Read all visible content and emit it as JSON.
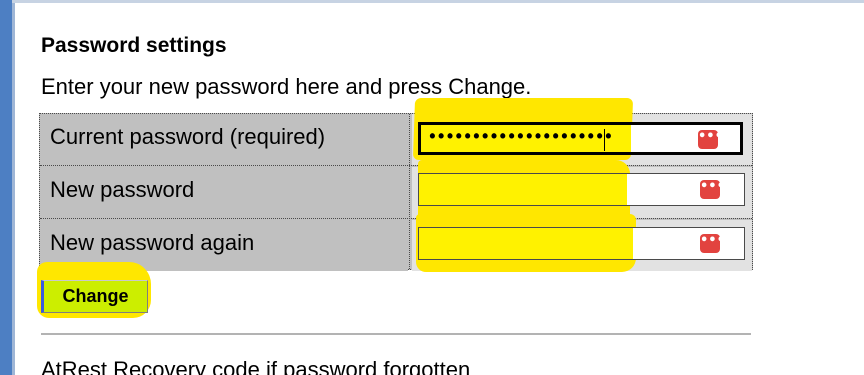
{
  "section": {
    "title": "Password settings",
    "description": "Enter your new password here and press Change."
  },
  "form": {
    "rows": [
      {
        "label": "Current password (required)",
        "value": "•••••••••••••••••••••",
        "icon": "password-manager-icon",
        "focused": true
      },
      {
        "label": "New password",
        "value": "",
        "icon": "password-manager-icon",
        "focused": false
      },
      {
        "label": "New password again",
        "value": "",
        "icon": "password-manager-icon",
        "focused": false
      }
    ],
    "submit_label": "Change"
  },
  "next_section": {
    "title": "AtRest Recovery code if password forgotten"
  },
  "colors": {
    "highlighter": "#ffe700",
    "autofill_yellow": "#fff200",
    "button_bg": "#ccee00",
    "icon_red": "#e2433f",
    "frame_blue": "#4d7fc3"
  }
}
